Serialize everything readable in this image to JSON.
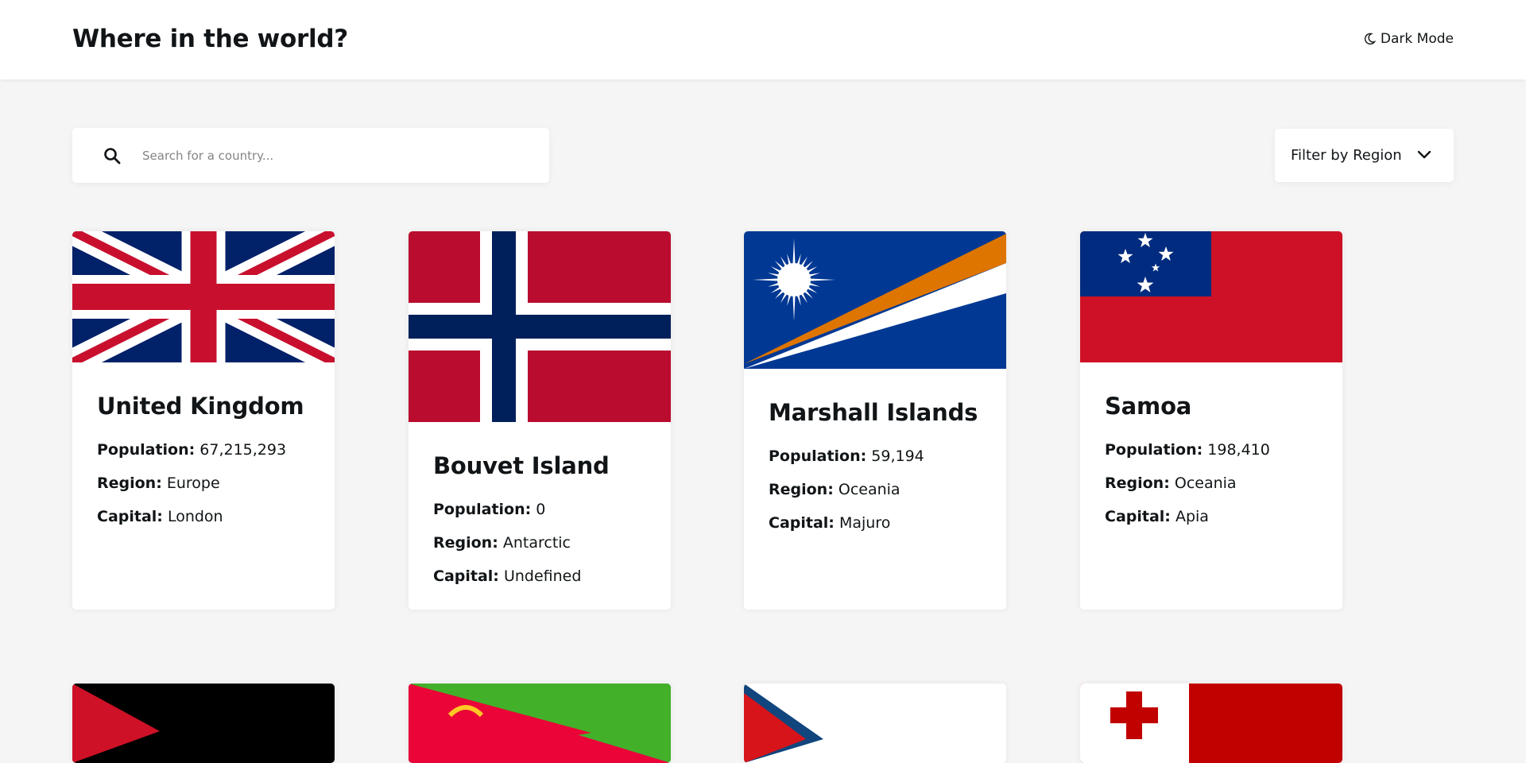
{
  "header": {
    "title": "Where in the world?",
    "theme_toggle": "Dark Mode"
  },
  "search": {
    "placeholder": "Search for a country..."
  },
  "filter": {
    "label": "Filter by Region"
  },
  "field_labels": {
    "population": "Population:",
    "region": "Region:",
    "capital": "Capital:"
  },
  "countries": [
    {
      "name": "United Kingdom",
      "population": "67,215,293",
      "region": "Europe",
      "capital": "London",
      "flag": "uk-flag"
    },
    {
      "name": "Bouvet Island",
      "population": "0",
      "region": "Antarctic",
      "capital": "Undefined",
      "flag": "norway-style-flag"
    },
    {
      "name": "Marshall Islands",
      "population": "59,194",
      "region": "Oceania",
      "capital": "Majuro",
      "flag": "marshall-islands-flag"
    },
    {
      "name": "Samoa",
      "population": "198,410",
      "region": "Oceania",
      "capital": "Apia",
      "flag": "samoa-flag"
    }
  ],
  "colors": {
    "page_bg": "#f5f5f5",
    "card_bg": "#ffffff",
    "text": "#111517"
  }
}
